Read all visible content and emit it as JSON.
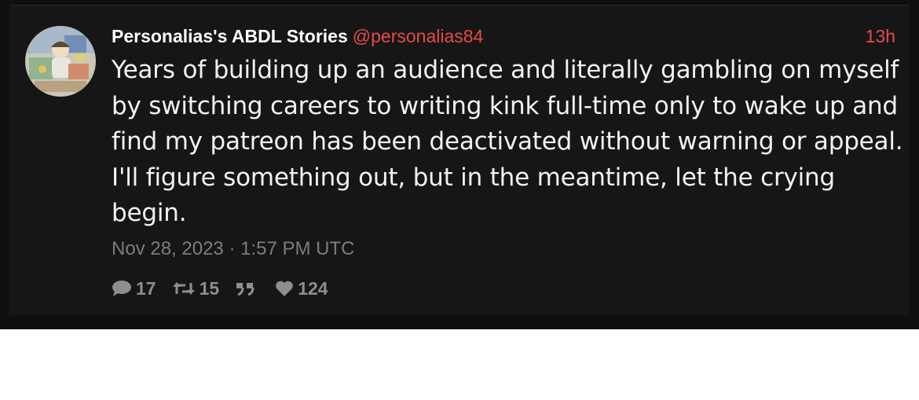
{
  "tweet": {
    "fullname": "Personalias's ABDL Stories",
    "username": "@personalias84",
    "time_ago": "13h",
    "text": "Years of building up an audience and literally gambling on myself by switching careers to writing kink full-time only to wake up and find my patreon has been deactivated without warning or appeal. I'll figure something out, but in the meantime, let the crying begin.",
    "date": "Nov 28, 2023 · 1:57 PM UTC"
  },
  "stats": {
    "replies": "17",
    "retweets": "15",
    "quotes": "",
    "likes": "124"
  },
  "icons": {
    "reply": "comment-icon",
    "retweet": "retweet-icon",
    "quote": "quote-icon",
    "like": "heart-icon"
  },
  "colors": {
    "accent": "#e84a4a",
    "background": "#161616",
    "text": "#f2f2f2",
    "muted": "#7d7d7d"
  }
}
